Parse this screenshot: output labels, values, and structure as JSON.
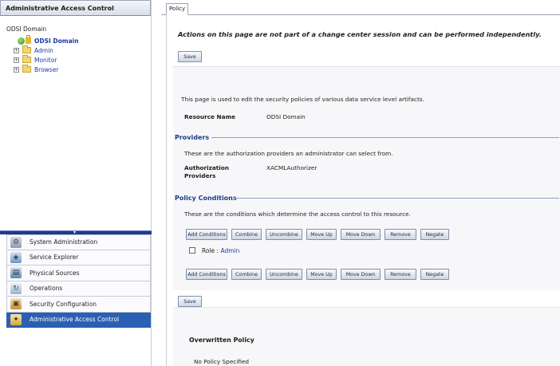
{
  "left_panel": {
    "title": "Administrative Access Control",
    "tree": {
      "root": "ODSI Domain",
      "domain_node": "ODSI Domain",
      "children": [
        "Admin",
        "Monitor",
        "Browser"
      ]
    },
    "nav": [
      {
        "label": "System Administration",
        "icon": "gears-icon"
      },
      {
        "label": "Service Explorer",
        "icon": "explorer-icon"
      },
      {
        "label": "Physical Sources",
        "icon": "database-icon"
      },
      {
        "label": "Operations",
        "icon": "operations-icon"
      },
      {
        "label": "Security Configuration",
        "icon": "security-icon"
      },
      {
        "label": "Administrative Access Control",
        "icon": "admin-access-icon",
        "active": true
      }
    ]
  },
  "tabs": {
    "policy": "Policy"
  },
  "main": {
    "notice": "Actions on this page are not part of a change center session and can be performed independently.",
    "save_label": "Save",
    "description": "This page is used to edit the security policies of various data service level artifacts.",
    "resource_name_label": "Resource Name",
    "resource_name_value": "ODSI Domain",
    "providers_heading": "Providers",
    "providers_desc": "These are the authorization providers an administrator can select from.",
    "auth_providers_label_1": "Authorization",
    "auth_providers_label_2": "Providers",
    "auth_providers_value": "XACMLAuthorizer",
    "conditions_heading": "Policy Conditions",
    "conditions_desc": "These are the conditions which determine the access control to this resource.",
    "buttons": {
      "add": "Add Conditions",
      "combine": "Combine",
      "uncombine": "Uncombine",
      "move_up": "Move Up",
      "move_down": "Move Down",
      "remove": "Remove",
      "negate": "Negate"
    },
    "role_prefix": "Role : ",
    "role_value": "Admin",
    "overwritten_heading": "Overwritten Policy",
    "no_policy": "No Policy Specified"
  },
  "colors": {
    "accent": "#2b5fb3",
    "link": "#1c3aa9",
    "section": "#1c3a8a"
  }
}
